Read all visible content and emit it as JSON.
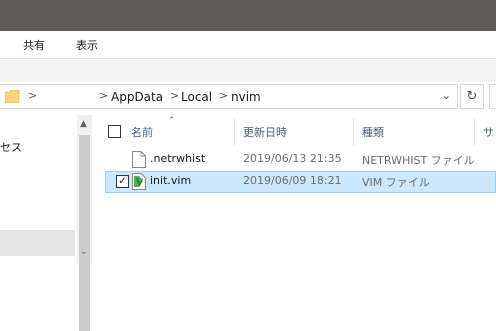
{
  "ribbon": {
    "tabs": [
      "共有",
      "表示"
    ]
  },
  "address": {
    "segments": [
      "AppData",
      "Local",
      "nvim"
    ],
    "separator": ">",
    "dropdown_icon": "chevron-down-icon",
    "refresh_icon": "refresh-icon"
  },
  "nav": {
    "items": [
      "セス"
    ]
  },
  "columns": {
    "name": "名前",
    "date": "更新日時",
    "type": "種類",
    "size": "サ"
  },
  "files": [
    {
      "name": ".netrwhist",
      "date": "2019/06/13 21:35",
      "type": "NETRWHIST ファイル",
      "selected": false
    },
    {
      "name": "init.vim",
      "date": "2019/06/09 18:21",
      "type": "VIM ファイル",
      "selected": true
    }
  ],
  "colors": {
    "selection": "#cce8ff",
    "selection_border": "#99d1ff",
    "titlebar": "#5e5a5a",
    "folder": "#f8d775"
  }
}
